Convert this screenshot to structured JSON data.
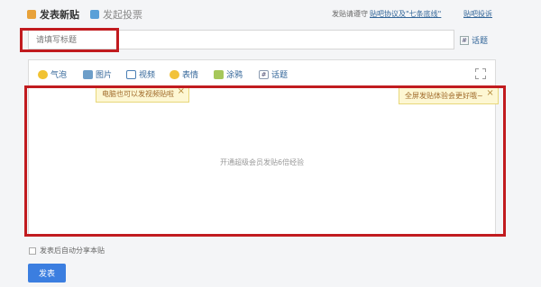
{
  "header": {
    "tab_post": "发表新贴",
    "tab_vote": "发起投票",
    "rules_prefix": "发贴请遵守",
    "rules_link": "贴吧协议及\"七条底线\"",
    "help_link": "贴吧投诉"
  },
  "title": {
    "placeholder": "请填写标题",
    "topic_icon": "#",
    "topic_label": "话题"
  },
  "toolbar": {
    "items": [
      {
        "label": "气泡",
        "icon": "bubble-icon"
      },
      {
        "label": "图片",
        "icon": "image-icon"
      },
      {
        "label": "视频",
        "icon": "video-icon"
      },
      {
        "label": "表情",
        "icon": "emoji-icon"
      },
      {
        "label": "涂鸦",
        "icon": "doodle-icon"
      },
      {
        "label": "话题",
        "icon": "topic-icon"
      }
    ],
    "topic_glyph": "#"
  },
  "tips": {
    "left": "电脑也可以发视频贴啦",
    "right": "全屏发贴体验会更好哦~",
    "close": "×"
  },
  "editor": {
    "placeholder": "开通超级会员发贴6倍经验"
  },
  "footer": {
    "auto_share": "发表后自动分享本贴",
    "submit": "发表"
  },
  "colors": {
    "accent": "#3b7ee0",
    "highlight": "#c11b1f",
    "link": "#336699"
  }
}
